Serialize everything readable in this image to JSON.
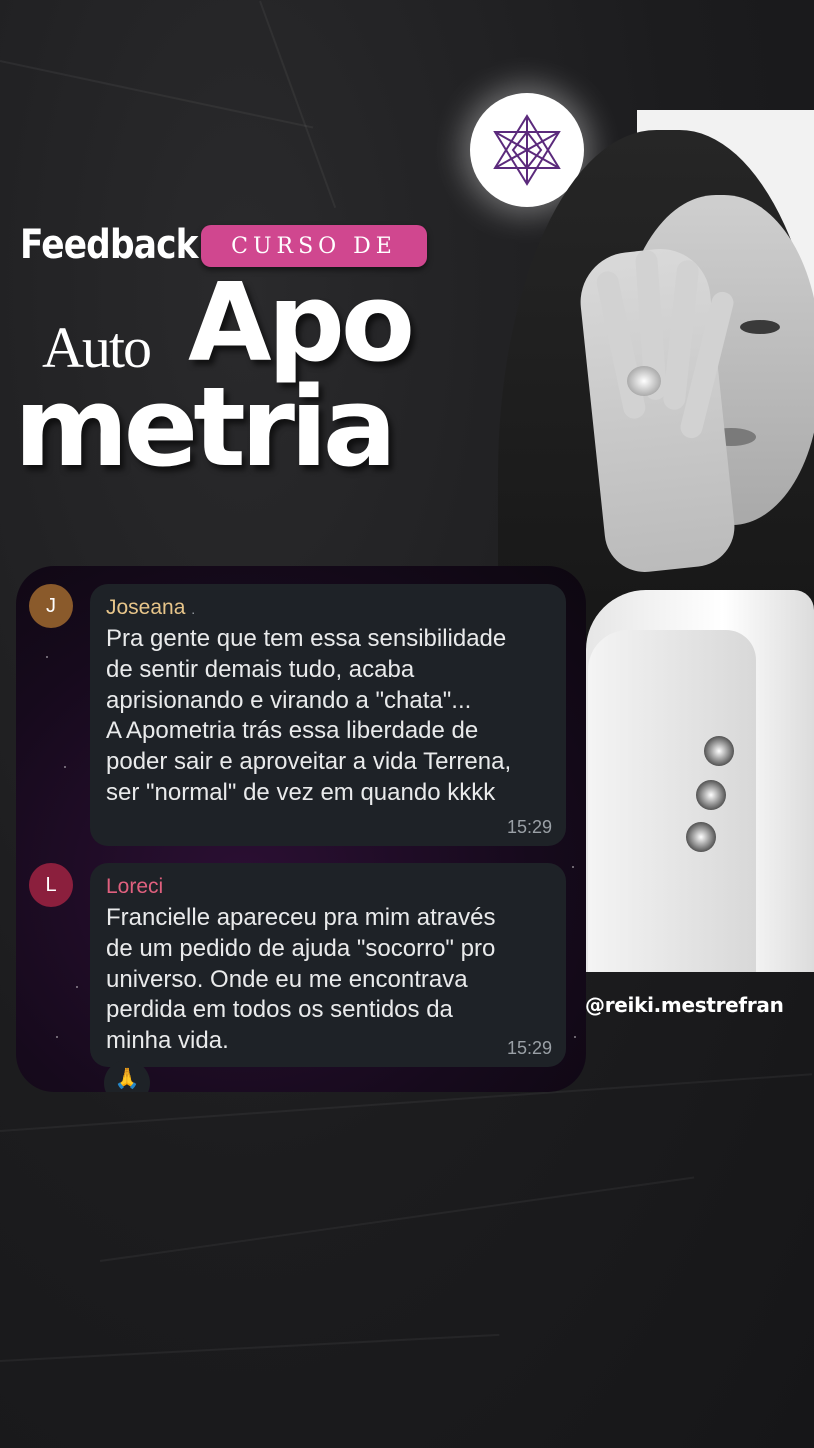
{
  "header": {
    "feedback": "Feedback",
    "badge": "CURSO DE",
    "auto": "Auto",
    "apo": "Apo",
    "metria": "metria"
  },
  "logo": {
    "icon": "merkaba-icon",
    "color": "#5b2a7c"
  },
  "handle": "@reiki.mestrefran",
  "messages": [
    {
      "initial": "J",
      "sender": "Joseana",
      "sender_suffix": ".",
      "sender_color": "#e7c58a",
      "avatar_color": "#8a5a2b",
      "text": "Pra gente que tem essa sensibilidade\nde sentir demais tudo, acaba\naprisionando e virando a \"chata\"...\nA Apometria trás essa liberdade de\npoder sair e aproveitar a vida Terrena,\nser \"normal\" de vez em quando kkkk",
      "time": "15:29"
    },
    {
      "initial": "L",
      "sender": "Loreci",
      "sender_color": "#e0607e",
      "avatar_color": "#8b1f3d",
      "text": "Francielle apareceu pra mim através\nde um pedido de ajuda \"socorro\" pro\nuniverso. Onde eu me encontrava\nperdida em todos os sentidos da\nminha vida.",
      "time": "15:29",
      "reaction": "🙏"
    }
  ],
  "colors": {
    "badge": "#d0478f",
    "chat_bg": "#1e2227"
  }
}
